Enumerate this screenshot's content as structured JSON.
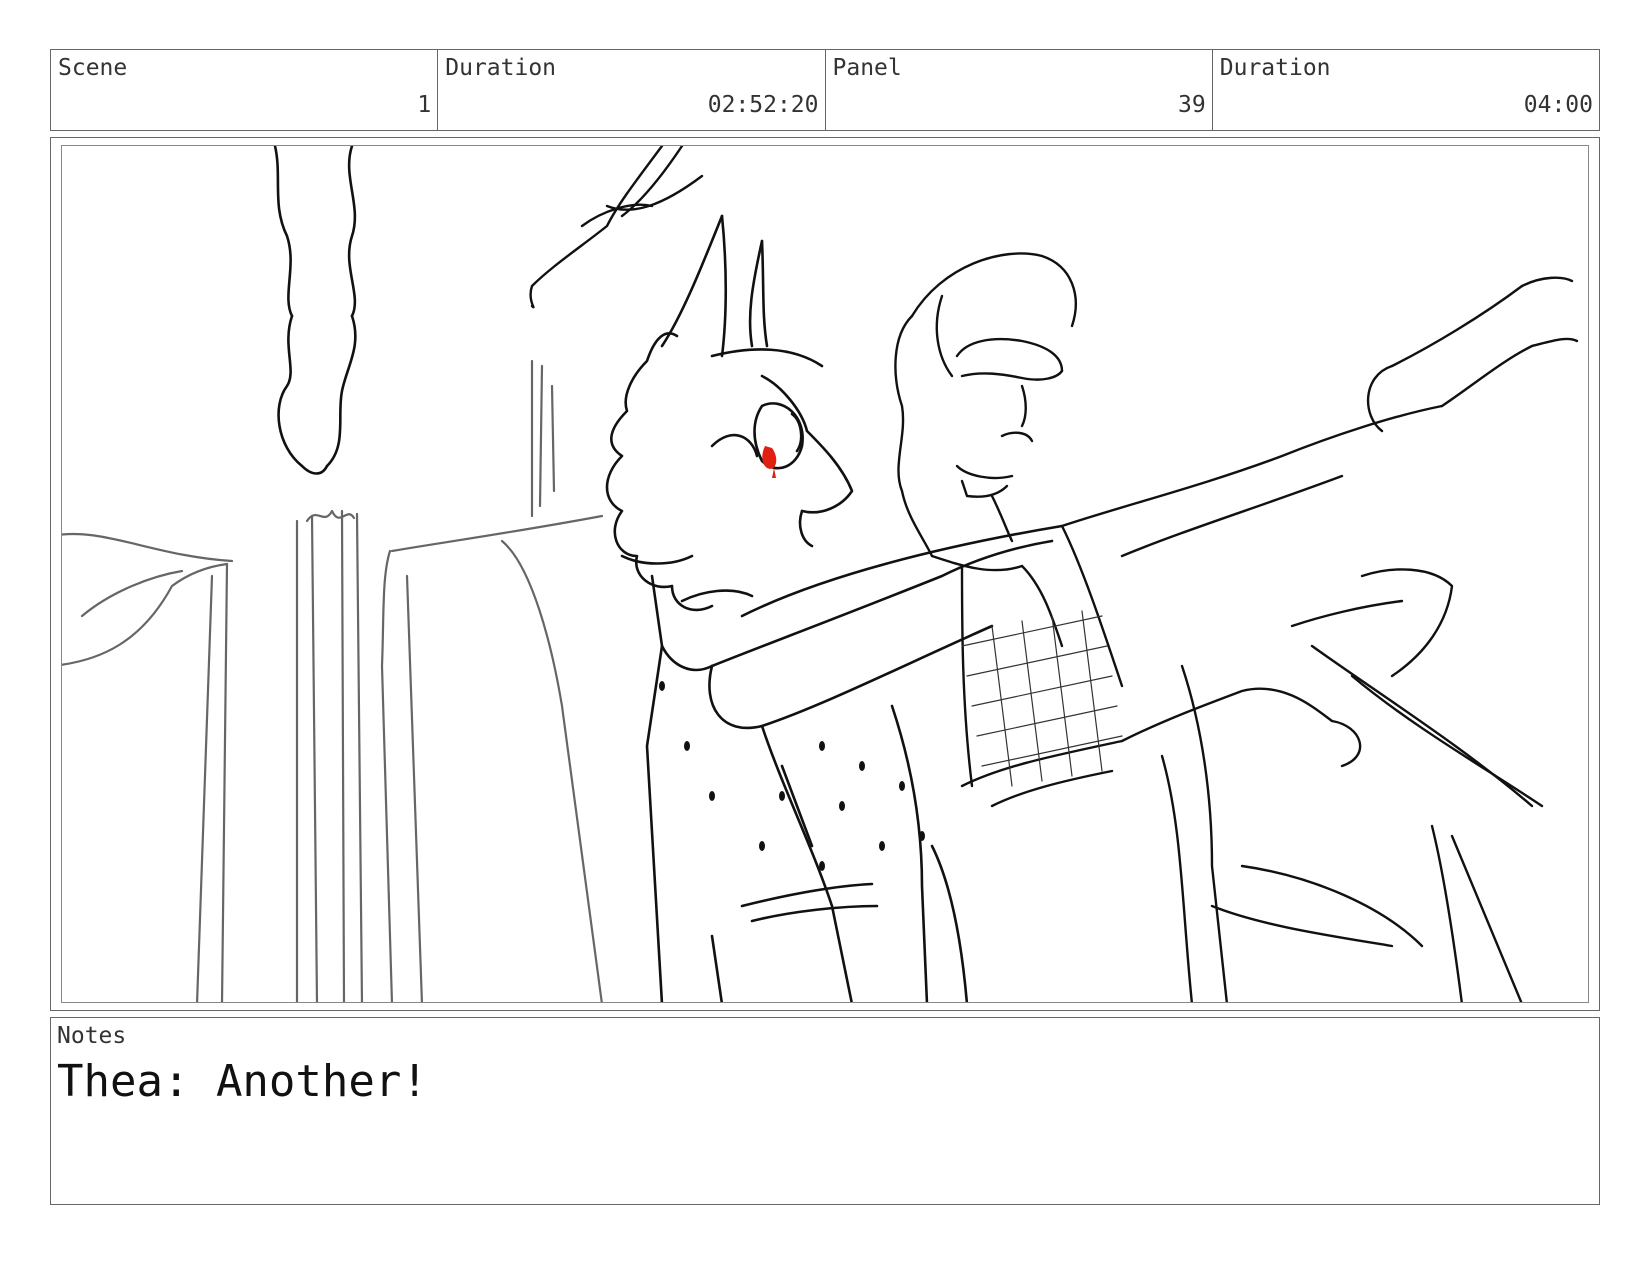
{
  "header": {
    "scene_label": "Scene",
    "scene_value": "1",
    "duration_label": "Duration",
    "duration_value": "02:52:20",
    "panel_label": "Panel",
    "panel_value": "39",
    "panel_duration_label": "Duration",
    "panel_duration_value": "04:00"
  },
  "notes": {
    "label": "Notes",
    "text": "Thea: Another!"
  },
  "colors": {
    "ink": "#111111",
    "pencil": "#555555",
    "blood": "#e02010"
  }
}
